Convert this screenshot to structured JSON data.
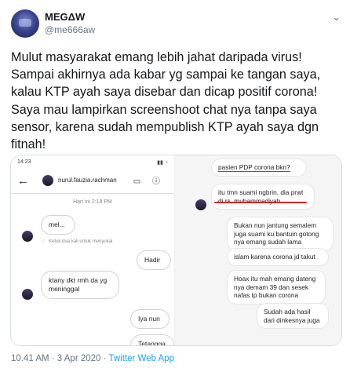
{
  "user": {
    "name": "MEGΔW",
    "handle": "@me666aw"
  },
  "tweet_text": "Mulut masyarakat emang lebih jahat daripada virus!\nSampai akhirnya ada kabar yg sampai ke tangan saya,\nkalau KTP ayah saya disebar dan dicap positif corona!\nSaya mau lampirkan screenshoot chat nya tanpa saya\nsensor, karena sudah mempublish KTP ayah saya dgn\nfitnah!",
  "left_chat": {
    "status_time": "14:23",
    "contact": "nurul.fauzia.rachman",
    "date_label": "Hari ini 2:18 PM",
    "msg1": "mel...",
    "reaction_hint": "Ketuk dua kali untuk menyukai",
    "msg2": "Hadir",
    "msg3": "ktany dkt rmh da yg meninggal",
    "msg4": "Iya nun",
    "msg5": "Tetangga ku"
  },
  "right_chat": {
    "msg1": "pasien PDP corona bkn?",
    "msg2": "itu tmn suami ngbrin, dia prwt di rs. muhammadiyah",
    "msg3": "Bukan nun jantung semalem juga suami ku bantuin gotong nya emang sudah lama",
    "msg4": "islam karena corona jd takut",
    "msg5": "Hoax itu mah emang dateng nya demam 39 dan sesek nafas tp bukan corona",
    "msg6": "Sudah ada hasil dari dinkesnya juga"
  },
  "timestamp": "10.41 AM · 3 Apr 2020 · ",
  "source": "Twitter Web App"
}
